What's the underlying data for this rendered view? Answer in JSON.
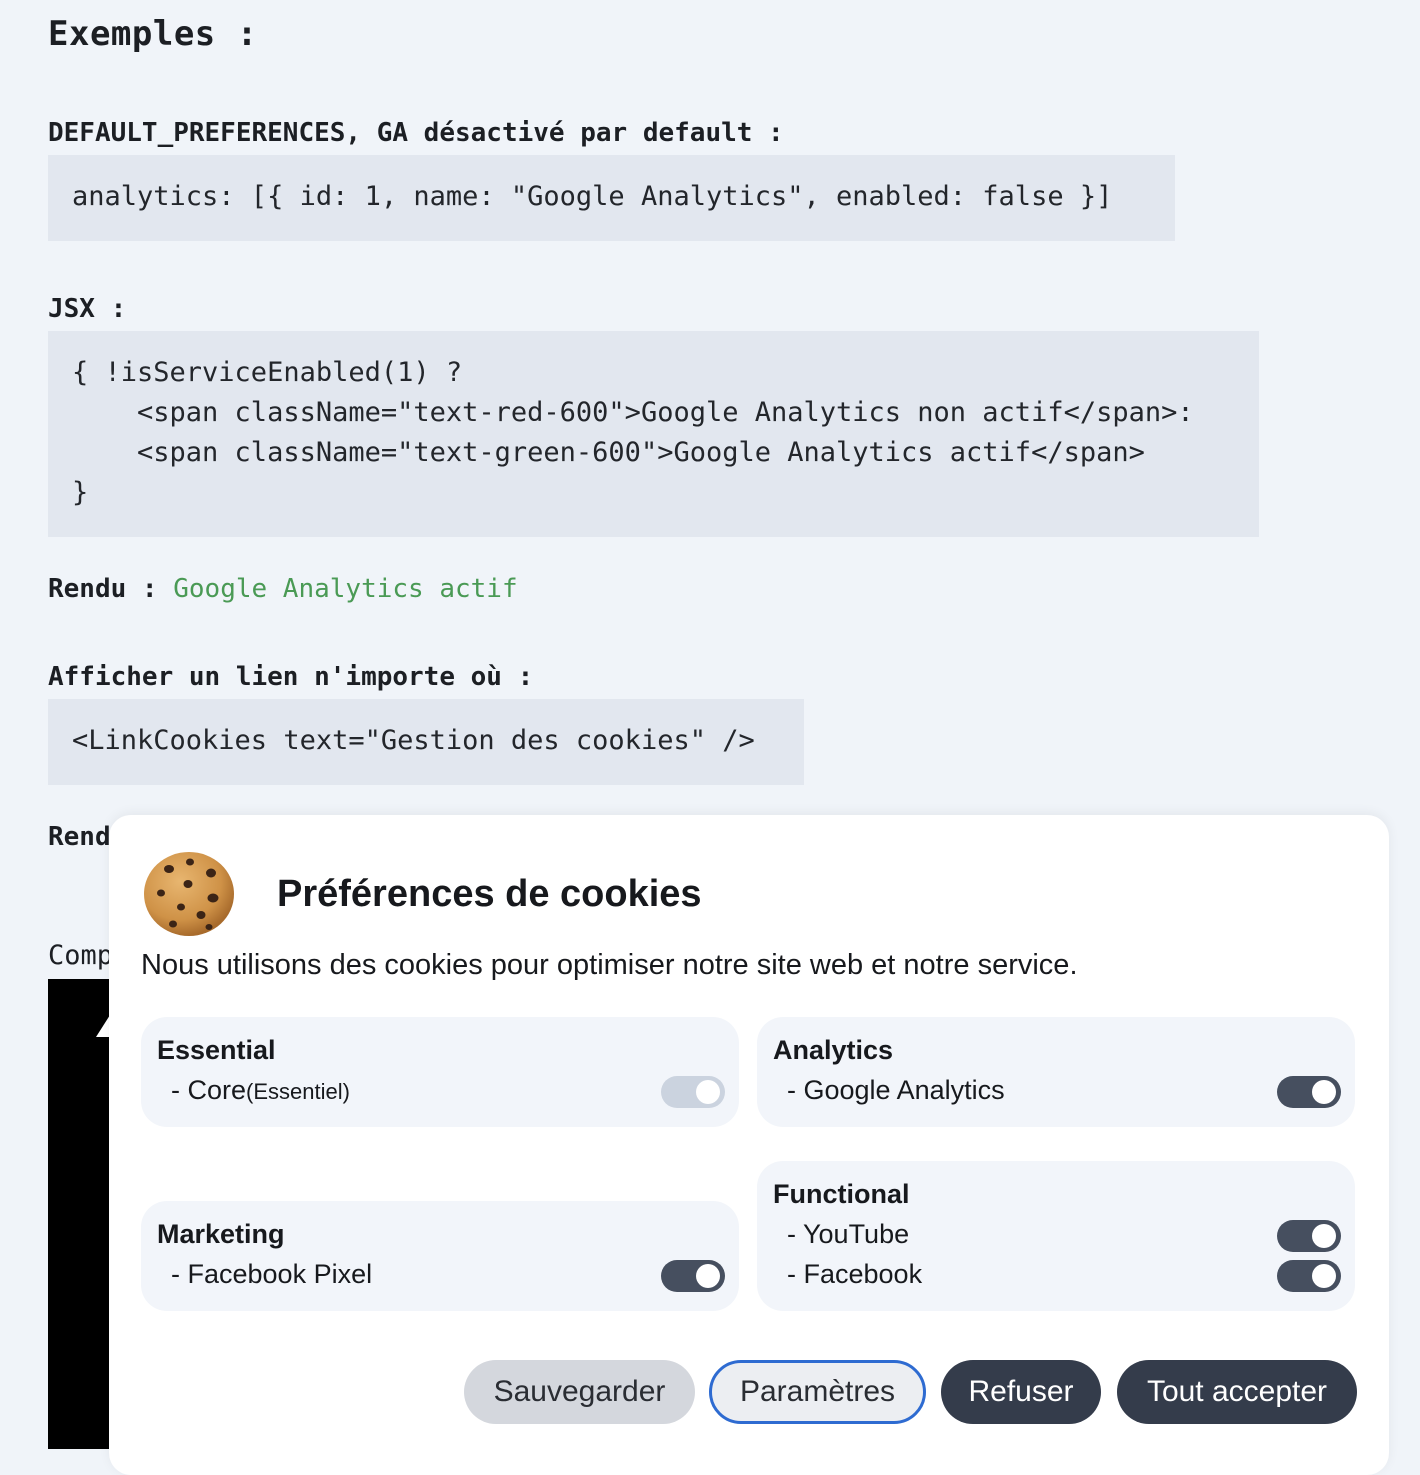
{
  "doc": {
    "heading": "Exemples :",
    "example1": {
      "label": "DEFAULT_PREFERENCES, GA désactivé par default :",
      "code": "analytics: [{ id: 1, name: \"Google Analytics\", enabled: false }]"
    },
    "example2": {
      "label": "JSX :",
      "code": "{ !isServiceEnabled(1) ?\n    <span className=\"text-red-600\">Google Analytics non actif</span>:\n    <span className=\"text-green-600\">Google Analytics actif</span>\n}"
    },
    "rendu1": {
      "label": "Rendu :",
      "value": "Google Analytics actif"
    },
    "example3": {
      "label": "Afficher un lien n'importe où :",
      "code": "<LinkCookies text=\"Gestion des cookies\" />"
    },
    "rendu2_label": "Rendu",
    "comp_label": "Comp"
  },
  "modal": {
    "icon": "cookie-icon",
    "title": "Préférences de cookies",
    "description": "Nous utilisons des cookies pour optimiser notre site web et notre service.",
    "categories": {
      "essential": {
        "title": "Essential",
        "services": [
          {
            "name": "- Core",
            "note": "(Essentiel)",
            "enabled": true,
            "locked": true
          }
        ]
      },
      "analytics": {
        "title": "Analytics",
        "services": [
          {
            "name": "- Google Analytics",
            "enabled": true
          }
        ]
      },
      "marketing": {
        "title": "Marketing",
        "services": [
          {
            "name": "- Facebook Pixel",
            "enabled": true
          }
        ]
      },
      "functional": {
        "title": "Functional",
        "services": [
          {
            "name": "- YouTube",
            "enabled": true
          },
          {
            "name": "- Facebook",
            "enabled": true
          }
        ]
      }
    },
    "buttons": {
      "save": "Sauvegarder",
      "settings": "Paramètres",
      "refuse": "Refuser",
      "accept_all": "Tout accepter"
    }
  },
  "colors": {
    "page_bg": "#f0f4f9",
    "code_bg": "#e2e7ef",
    "green_text": "#4a9a55",
    "toggle_on": "#464f5f",
    "toggle_locked": "#cbd3df",
    "dark_button": "#343c4b",
    "focus_outline": "#2e6bd1"
  }
}
